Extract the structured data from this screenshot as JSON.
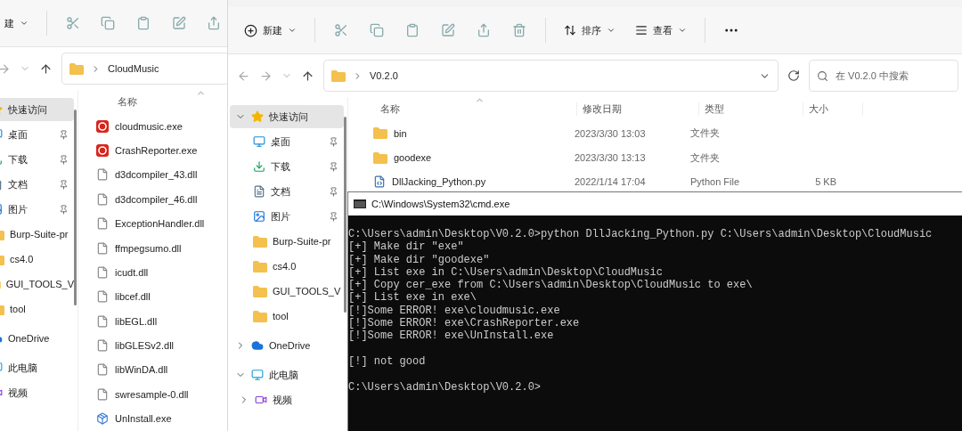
{
  "back_window": {
    "toolbar": {
      "new_label": "建"
    },
    "address": {
      "path": "CloudMusic"
    },
    "sidebar": {
      "items": [
        {
          "label": "快速访问",
          "kind": "quick",
          "selected": true,
          "pinned": false
        },
        {
          "label": "桌面",
          "kind": "desktop",
          "selected": false,
          "pinned": true
        },
        {
          "label": "下载",
          "kind": "download",
          "selected": false,
          "pinned": true
        },
        {
          "label": "文档",
          "kind": "docs",
          "selected": false,
          "pinned": true
        },
        {
          "label": "图片",
          "kind": "pictures",
          "selected": false,
          "pinned": true
        },
        {
          "label": "Burp-Suite-pr",
          "kind": "folder",
          "selected": false,
          "pinned": false
        },
        {
          "label": "cs4.0",
          "kind": "folder",
          "selected": false,
          "pinned": false
        },
        {
          "label": "GUI_TOOLS_V",
          "kind": "folder",
          "selected": false,
          "pinned": false
        },
        {
          "label": "tool",
          "kind": "folder",
          "selected": false,
          "pinned": false
        },
        {
          "label": "OneDrive",
          "kind": "onedrive",
          "selected": false,
          "pinned": false
        },
        {
          "label": "此电脑",
          "kind": "pc",
          "selected": false,
          "pinned": false
        },
        {
          "label": "视频",
          "kind": "video",
          "selected": false,
          "pinned": false
        }
      ]
    },
    "files": {
      "column": "名称",
      "items": [
        {
          "name": "cloudmusic.exe",
          "kind": "app"
        },
        {
          "name": "CrashReporter.exe",
          "kind": "app"
        },
        {
          "name": "d3dcompiler_43.dll",
          "kind": "dll"
        },
        {
          "name": "d3dcompiler_46.dll",
          "kind": "dll"
        },
        {
          "name": "ExceptionHandler.dll",
          "kind": "dll"
        },
        {
          "name": "ffmpegsumo.dll",
          "kind": "dll"
        },
        {
          "name": "icudt.dll",
          "kind": "dll"
        },
        {
          "name": "libcef.dll",
          "kind": "dll"
        },
        {
          "name": "libEGL.dll",
          "kind": "dll"
        },
        {
          "name": "libGLESv2.dll",
          "kind": "dll"
        },
        {
          "name": "libWinDA.dll",
          "kind": "dll"
        },
        {
          "name": "swresample-0.dll",
          "kind": "dll"
        },
        {
          "name": "UnInstall.exe",
          "kind": "installer"
        }
      ]
    }
  },
  "front_window": {
    "toolbar": {
      "new_label": "新建",
      "sort_label": "排序",
      "view_label": "查看"
    },
    "address": {
      "path": "V0.2.0"
    },
    "search": {
      "placeholder": "在 V0.2.0 中搜索"
    },
    "sidebar": {
      "items": [
        {
          "label": "快速访问",
          "kind": "quick",
          "selected": true,
          "pinned": false,
          "expanded": true
        },
        {
          "label": "桌面",
          "kind": "desktop",
          "selected": false,
          "pinned": true
        },
        {
          "label": "下载",
          "kind": "download",
          "selected": false,
          "pinned": true
        },
        {
          "label": "文档",
          "kind": "docs",
          "selected": false,
          "pinned": true
        },
        {
          "label": "图片",
          "kind": "pictures",
          "selected": false,
          "pinned": true
        },
        {
          "label": "Burp-Suite-pr",
          "kind": "folder",
          "selected": false,
          "pinned": false
        },
        {
          "label": "cs4.0",
          "kind": "folder",
          "selected": false,
          "pinned": false
        },
        {
          "label": "GUI_TOOLS_V",
          "kind": "folder",
          "selected": false,
          "pinned": false
        },
        {
          "label": "tool",
          "kind": "folder",
          "selected": false,
          "pinned": false
        },
        {
          "label": "OneDrive",
          "kind": "onedrive",
          "selected": false,
          "pinned": false,
          "expanded": false
        },
        {
          "label": "此电脑",
          "kind": "pc",
          "selected": false,
          "pinned": false,
          "expanded": true
        },
        {
          "label": "视频",
          "kind": "video",
          "selected": false,
          "pinned": false,
          "expanded": false
        }
      ]
    },
    "table": {
      "columns": [
        "名称",
        "修改日期",
        "类型",
        "大小"
      ],
      "rows": [
        {
          "name": "bin",
          "kind": "folder",
          "modified": "2023/3/30 13:03",
          "type": "文件夹"
        },
        {
          "name": "goodexe",
          "kind": "folder",
          "modified": "2023/3/30 13:13",
          "type": "文件夹"
        },
        {
          "name": "DllJacking_Python.py",
          "kind": "python",
          "modified": "2022/1/14 17:04",
          "type": "Python File",
          "size": "5 KB"
        }
      ]
    }
  },
  "console": {
    "title": "C:\\Windows\\System32\\cmd.exe",
    "blocks": [
      [
        "C:\\Users\\admin\\Desktop\\V0.2.0>python DllJacking_Python.py C:\\Users\\admin\\Desktop\\CloudMusic",
        "[+] Make dir \"exe\"",
        "[+] Make dir \"goodexe\"",
        "[+] List exe in C:\\Users\\admin\\Desktop\\CloudMusic",
        "[+] Copy cer_exe from C:\\Users\\admin\\Desktop\\CloudMusic to exe\\",
        "[+] List exe in exe\\",
        "[!]Some ERROR! exe\\cloudmusic.exe",
        "[!]Some ERROR! exe\\CrashReporter.exe",
        "[!]Some ERROR! exe\\UnInstall.exe"
      ],
      [
        "[!] not good"
      ],
      [
        "C:\\Users\\admin\\Desktop\\V0.2.0>"
      ]
    ]
  }
}
